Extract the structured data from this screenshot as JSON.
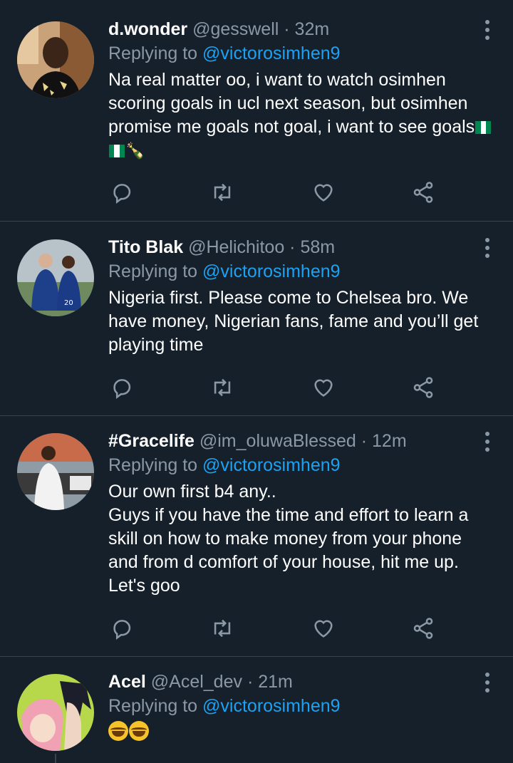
{
  "tweets": [
    {
      "name": "d.wonder",
      "handle": "@gesswell",
      "dot": " · ",
      "time": "32m",
      "replying_prefix": "Replying to ",
      "replying_to": "@victorosimhen9",
      "text": "Na real matter oo, i want to watch osimhen scoring goals in ucl next season, but osimhen promise me goals not goal, i want to see goals",
      "emojis": [
        "nigeria-flag",
        "nigeria-flag",
        "bottle"
      ]
    },
    {
      "name": "Tito Blak",
      "handle": "@Helichitoo",
      "dot": " · ",
      "time": "58m",
      "replying_prefix": "Replying to ",
      "replying_to": "@victorosimhen9",
      "text": "Nigeria first. Please come to Chelsea bro. We have money, Nigerian fans, fame and you’ll get playing time"
    },
    {
      "name": "#Gracelife",
      "handle": "@im_oluwaBlessed",
      "dot": " · ",
      "time": "12m",
      "replying_prefix": "Replying to ",
      "replying_to": "@victorosimhen9",
      "text": "Our own first b4 any..\nGuys if you have the time and effort to learn a skill on how to make money from your phone and from d comfort of your house, hit me up. Let's goo"
    },
    {
      "name": "Acel",
      "handle": "@Acel_dev",
      "dot": " · ",
      "time": "21m",
      "replying_prefix": "Replying to ",
      "replying_to": "@victorosimhen9",
      "emojis": [
        "laughing-face",
        "laughing-face"
      ]
    }
  ],
  "colors": {
    "background": "#15202b",
    "divider": "#38444d",
    "secondary_text": "#8b98a5",
    "mention": "#1da1f2",
    "nigeria_green": "#008751"
  },
  "icons": [
    "reply-icon",
    "retweet-icon",
    "like-icon",
    "share-icon",
    "more-options-icon"
  ]
}
